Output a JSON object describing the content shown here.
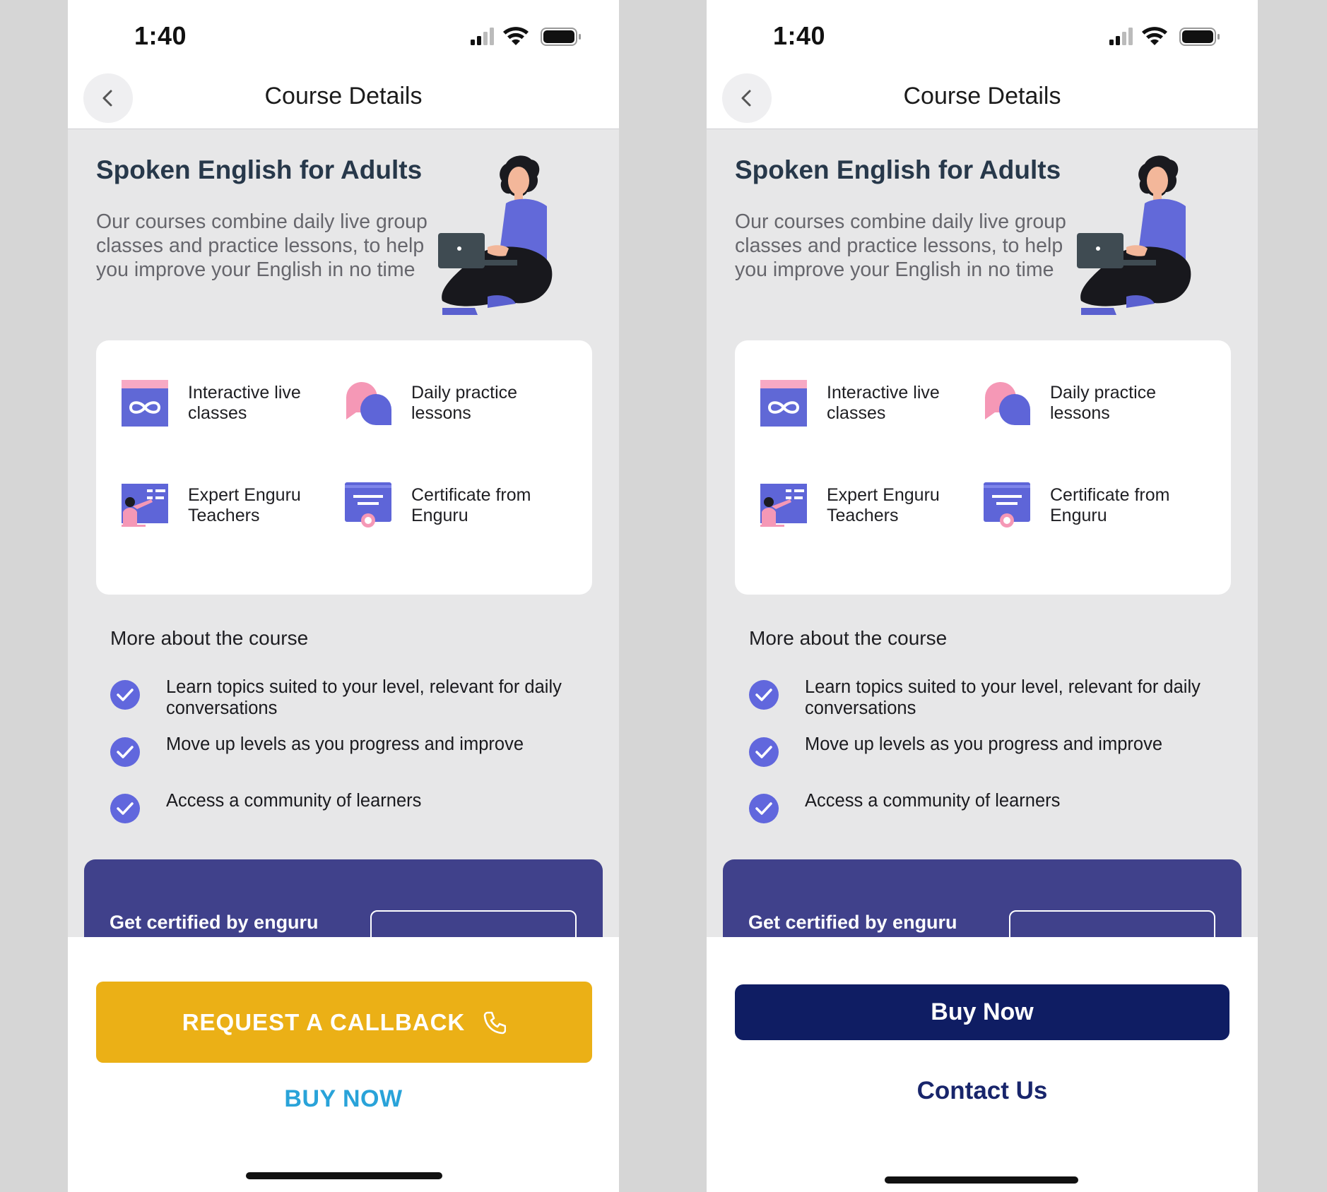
{
  "screens": [
    {
      "status_time": "1:40",
      "nav_title": "Course Details",
      "course_title": "Spoken English for Adults",
      "course_description": "Our courses combine daily live group classes and practice lessons, to help you improve your English in no time",
      "features": [
        {
          "label": "Interactive live classes",
          "icon": "infinity-screen-icon"
        },
        {
          "label": "Daily practice lessons",
          "icon": "chat-bubbles-icon"
        },
        {
          "label": "Expert Enguru Teachers",
          "icon": "teacher-board-icon"
        },
        {
          "label": "Certificate from Enguru",
          "icon": "certificate-icon"
        }
      ],
      "more_title": "More about the course",
      "bullets": [
        "Learn topics suited to your level, relevant for daily conversations",
        "Move up levels as you progress and improve",
        "Access a community of learners"
      ],
      "cert_banner_text": "Get certified by enguru",
      "primary_button": "REQUEST A CALLBACK",
      "secondary_link": "BUY NOW"
    },
    {
      "status_time": "1:40",
      "nav_title": "Course Details",
      "course_title": "Spoken English for Adults",
      "course_description": "Our courses combine daily live group classes and practice lessons, to help you improve your English in no time",
      "features": [
        {
          "label": "Interactive live classes",
          "icon": "infinity-screen-icon"
        },
        {
          "label": "Daily practice lessons",
          "icon": "chat-bubbles-icon"
        },
        {
          "label": "Expert Enguru Teachers",
          "icon": "teacher-board-icon"
        },
        {
          "label": "Certificate from Enguru",
          "icon": "certificate-icon"
        }
      ],
      "more_title": "More about the course",
      "bullets": [
        "Learn topics suited to your level, relevant for daily conversations",
        "Move up levels as you progress and improve",
        "Access a community of learners"
      ],
      "cert_banner_text": "Get certified by enguru",
      "primary_button": "Buy Now",
      "secondary_link": "Contact Us"
    }
  ],
  "colors": {
    "callback_yellow": "#ebb016",
    "buy_link_blue": "#29a3d9",
    "buy_now_navy": "#0f1d63",
    "contact_navy": "#18256b",
    "banner_purple": "#40418b",
    "check_purple": "#6167dd",
    "page_grey": "#e7e7e8"
  }
}
